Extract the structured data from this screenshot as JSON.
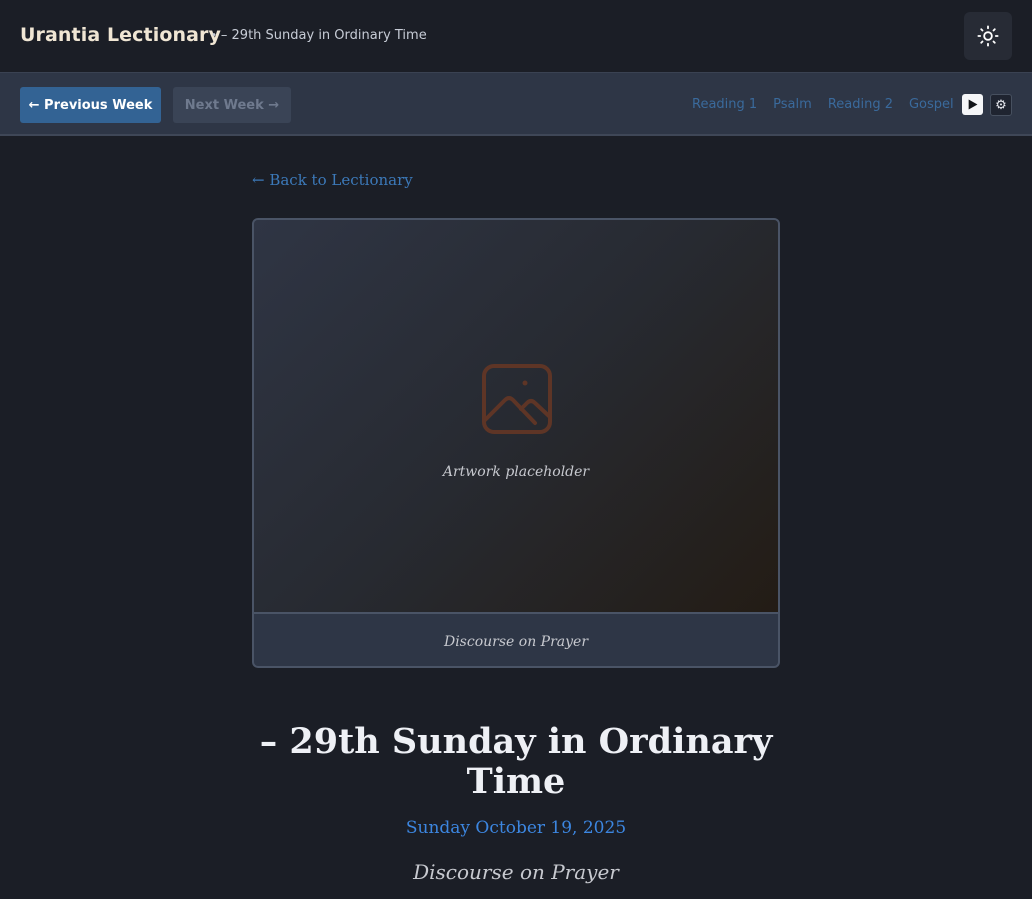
{
  "header": {
    "brand": "Urantia Lectionary",
    "breadcrumb_dot": "•",
    "breadcrumb": "– 29th Sunday in Ordinary Time",
    "theme_icon": "sun-icon"
  },
  "nav": {
    "prev_label": "← Previous Week",
    "next_label": "Next Week →",
    "sections": [
      "Reading 1",
      "Psalm",
      "Reading 2",
      "Gospel"
    ],
    "play_icon": "play-icon",
    "settings_icon": "gear-icon",
    "settings_glyph": "⚙"
  },
  "main": {
    "back_link": "← Back to Lectionary",
    "artwork": {
      "icon": "image-icon",
      "placeholder_text": "Artwork placeholder",
      "caption": "Discourse on Prayer"
    },
    "title": "– 29th Sunday in Ordinary Time",
    "date": "Sunday October 19, 2025",
    "subtitle": "Discourse on Prayer"
  },
  "colors": {
    "background": "#1b1e26",
    "accent": "#336394",
    "link": "#3c79b9",
    "date": "#3c86e0",
    "brand": "#f0e6d4"
  }
}
